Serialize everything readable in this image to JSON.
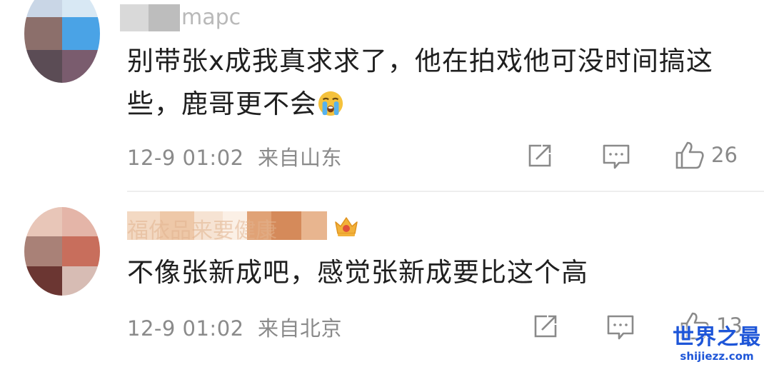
{
  "comments": [
    {
      "username_visible_fragment": "mapc",
      "text_before_emoji": "别带张x成我真求求了，他在拍戏他可没时间搞这些，鹿哥更不会",
      "emoji_icon": "crying-face-icon",
      "timestamp": "12-9 01:02",
      "location": "来自山东",
      "like_count": "26"
    },
    {
      "username_visible_fragment": "福依品来要健康",
      "badge_icon": "crown-badge-icon",
      "text": "不像张新成吧，感觉张新成要比这个高",
      "timestamp": "12-9 01:02",
      "location": "来自北京",
      "like_count": "13"
    }
  ],
  "actions": {
    "share_icon": "share-icon",
    "comment_icon": "comment-icon",
    "like_icon": "thumbs-up-icon"
  },
  "watermark": {
    "title": "世界之最",
    "url": "shijiezz.com"
  },
  "colors": {
    "text": "#1f1f1f",
    "meta": "#8a8a8a",
    "watermark": "#1e56d8"
  }
}
